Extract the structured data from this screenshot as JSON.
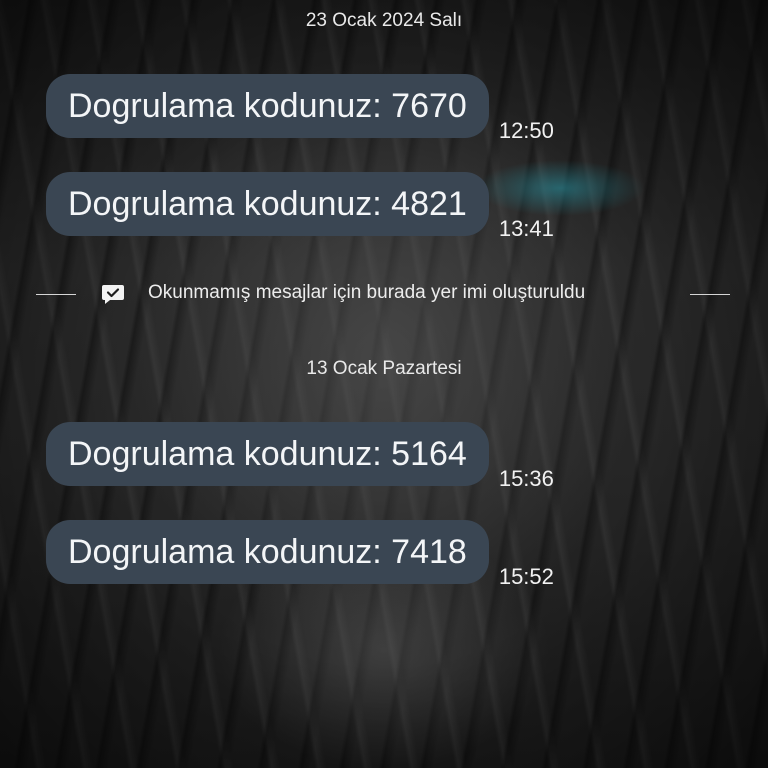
{
  "conversation": {
    "date_separators": [
      "23 Ocak 2024 Salı",
      "13 Ocak Pazartesi"
    ],
    "messages": [
      {
        "text": "Dogrulama kodunuz: 7670",
        "time": "12:50"
      },
      {
        "text": "Dogrulama kodunuz: 4821",
        "time": "13:41"
      },
      {
        "text": "Dogrulama kodunuz: 5164",
        "time": "15:36"
      },
      {
        "text": "Dogrulama kodunuz: 7418",
        "time": "15:52"
      }
    ],
    "bookmark_notice": {
      "text": "Okunmamış mesajlar için burada yer imi oluşturuldu",
      "icon": "bookmark-check-icon"
    }
  },
  "colors": {
    "bubble": "#3a4653",
    "bubble_text": "#f3f5f7",
    "timestamp": "#f2f2f2",
    "separator_text": "#e9e9e9"
  }
}
